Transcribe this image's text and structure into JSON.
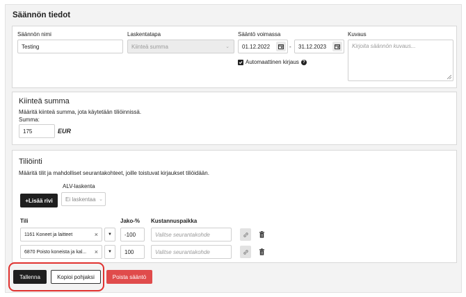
{
  "section": {
    "title": "Säännön tiedot"
  },
  "rule": {
    "name_label": "Säännön nimi",
    "name_value": "Testing",
    "method_label": "Laskentatapa",
    "method_value": "Kiinteä summa",
    "validity_label": "Sääntö voimassa",
    "start_date": "01.12.2022",
    "date_separator": "-",
    "end_date": "31.12.2023",
    "auto_label": "Automaattinen kirjaus",
    "auto_checked": true,
    "description_label": "Kuvaus",
    "description_placeholder": "Kirjoita säännön kuvaus..."
  },
  "fixed_sum": {
    "title": "Kiinteä summa",
    "description": "Määritä kiinteä summa, jota käytetään tiliöinnissä.",
    "amount_label": "Summa:",
    "amount_value": "175",
    "currency": "EUR"
  },
  "posting": {
    "title": "Tiliöinti",
    "description": "Määritä tilit ja mahdolliset seurantakohteet, joille toistuvat kirjaukset tiliöidään.",
    "add_row_label": "+Lisää rivi",
    "vat_label": "ALV-laskenta",
    "vat_value": "Ei laskentaa",
    "col_account": "Tili",
    "col_share": "Jako-%",
    "col_cost_center": "Kustannuspaikka",
    "rows": [
      {
        "account": "1161 Koneet ja laitteet",
        "share": "-100",
        "cost_center_placeholder": "Valitse seurantakohde"
      },
      {
        "account": "6870 Poisto koneista ja kal...",
        "share": "100",
        "cost_center_placeholder": "Valitse seurantakohde"
      }
    ]
  },
  "actions": {
    "save_label": "Tallenna",
    "copy_label": "Kopioi pohjaksi",
    "delete_label": "Poista sääntö"
  },
  "colors": {
    "primary_dark": "#1f1f1f",
    "danger": "#e04b4b",
    "annotation": "#e0312f"
  }
}
